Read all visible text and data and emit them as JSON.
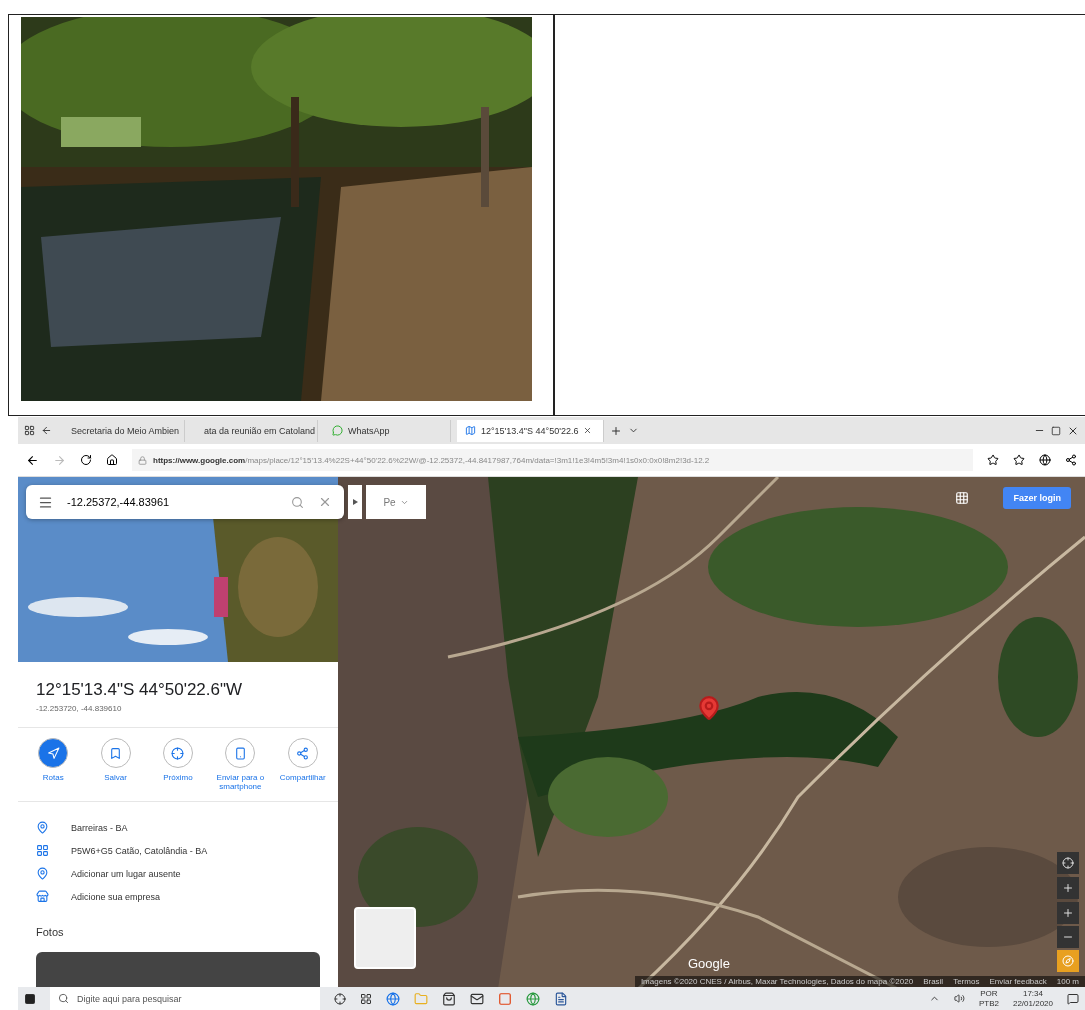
{
  "browser": {
    "tabs": [
      {
        "label": "Secretaria do Meio Ambien",
        "kind": "page",
        "selected": false
      },
      {
        "label": "ata da reunião em Catoland",
        "kind": "pdf",
        "selected": false
      },
      {
        "label": "WhatsApp",
        "kind": "chat",
        "selected": false
      },
      {
        "label": "12°15'13.4\"S 44°50'22.6",
        "kind": "map",
        "selected": true
      }
    ],
    "url_host": "https://www.google.com",
    "url_path": "/maps/place/12°15'13.4%22S+44°50'22.6%22W/@-12.25372,-44.8417987,764m/data=!3m1!1e3!4m5!3m4!1s0x0:0x0!8m2!3d-12.2"
  },
  "maps": {
    "search": {
      "value": "-12.25372,-44.83961"
    },
    "mode_select": "Pe",
    "login_button": "Fazer login",
    "place": {
      "title": "12°15'13.4\"S 44°50'22.6\"W",
      "coords": "-12.253720, -44.839610"
    },
    "actions": [
      {
        "label": "Rotas",
        "selected": true
      },
      {
        "label": "Salvar",
        "selected": false
      },
      {
        "label": "Próximo",
        "selected": false
      },
      {
        "label": "Enviar para o smartphone",
        "selected": false
      },
      {
        "label": "Compartilhar",
        "selected": false
      }
    ],
    "info": [
      "Barreiras - BA",
      "P5W6+G5 Catão, Catolândia - BA",
      "Adicionar um lugar ausente",
      "Adicione sua empresa"
    ],
    "photos_heading": "Fotos",
    "map_logo": "Google",
    "attribution": [
      "Imagens ©2020 CNES / Airbus, Maxar Technologies, Dados do mapa ©2020",
      "Brasil",
      "Termos",
      "Enviar feedback",
      "100 m"
    ]
  },
  "taskbar": {
    "search_placeholder": "Digite aqui para pesquisar",
    "language": "POR",
    "layout": "PTB2",
    "time": "17:34",
    "date": "22/01/2020"
  }
}
